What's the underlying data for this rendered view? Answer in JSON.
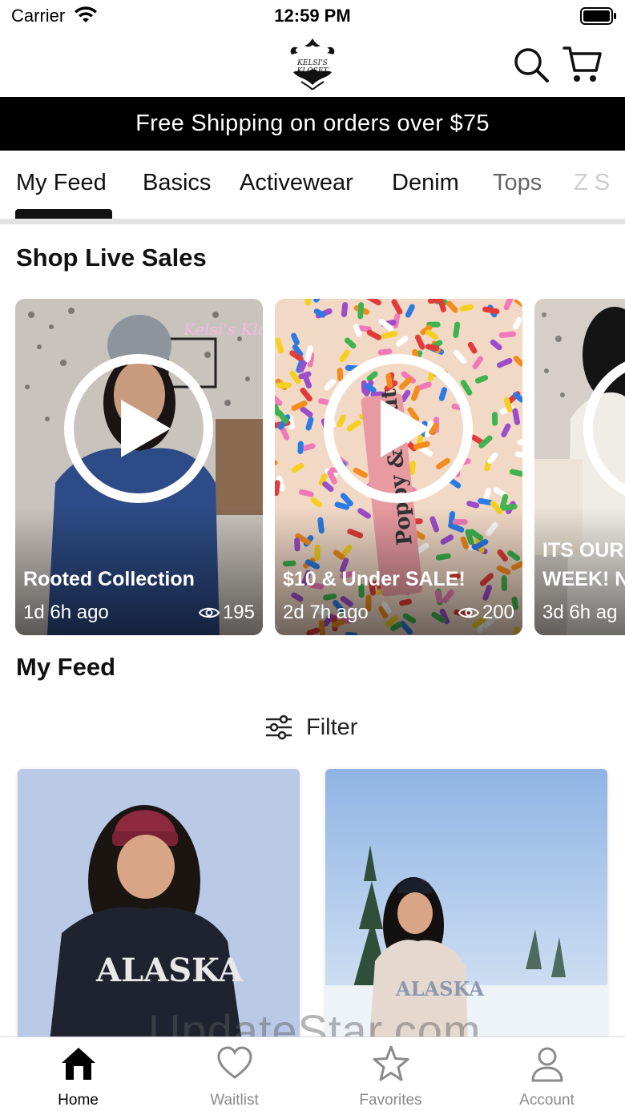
{
  "status_bar": {
    "carrier": "Carrier",
    "time": "12:59 PM"
  },
  "header": {
    "logo_text": "KELSI'S KLOSET",
    "icons": [
      "search-icon",
      "cart-icon"
    ]
  },
  "promo": {
    "text": "Free Shipping on orders over $75"
  },
  "tabs": [
    {
      "label": "My Feed",
      "active": true
    },
    {
      "label": "Basics"
    },
    {
      "label": "Activewear"
    },
    {
      "label": "Denim"
    },
    {
      "label": "Tops"
    },
    {
      "label": "Z S"
    }
  ],
  "live_sales": {
    "title": "Shop Live Sales",
    "cards": [
      {
        "title": "Rooted Collection",
        "time": "1d 6h ago",
        "views": "195"
      },
      {
        "title": "$10 & Under SALE!",
        "time": "2d 7h ago",
        "views": "200"
      },
      {
        "title": "ITS OUR",
        "title2": "WEEK! N",
        "time": "3d 6h ag"
      }
    ]
  },
  "feed": {
    "title": "My Feed",
    "filter_label": "Filter"
  },
  "watermark": "UpdateStar.com",
  "bottom_nav": [
    {
      "label": "Home",
      "icon": "home-icon",
      "active": true
    },
    {
      "label": "Waitlist",
      "icon": "heart-icon"
    },
    {
      "label": "Favorites",
      "icon": "star-icon"
    },
    {
      "label": "Account",
      "icon": "person-icon"
    }
  ],
  "colors": {
    "banner_bg": "#000000",
    "active_tab": "#111111",
    "inactive_nav": "#8a8a8a"
  }
}
